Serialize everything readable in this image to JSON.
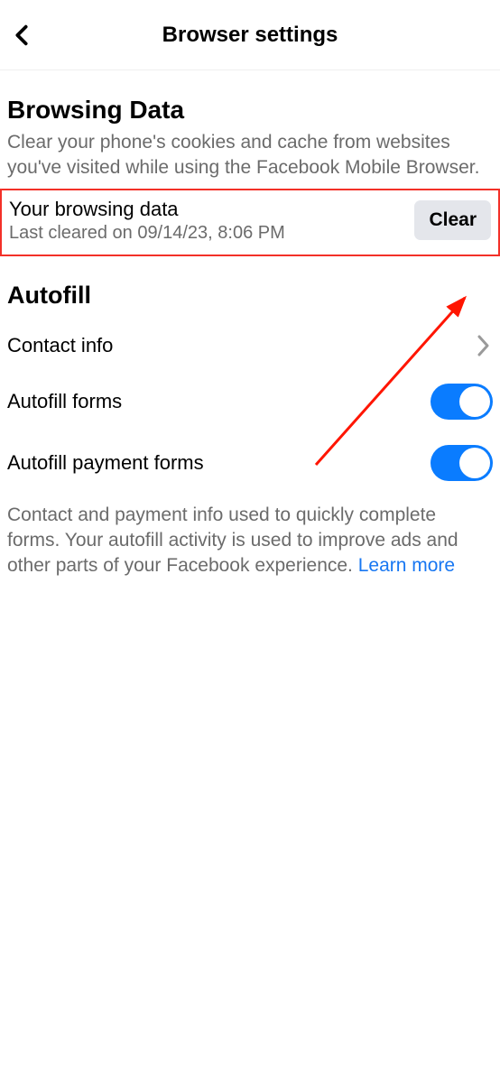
{
  "header": {
    "title": "Browser settings"
  },
  "browsingData": {
    "sectionTitle": "Browsing Data",
    "description": "Clear your phone's cookies and cache from websites you've visited while using the Facebook Mobile Browser.",
    "rowTitle": "Your browsing data",
    "rowSubtitle": "Last cleared on 09/14/23, 8:06 PM",
    "clearLabel": "Clear"
  },
  "autofill": {
    "sectionTitle": "Autofill",
    "contactLabel": "Contact info",
    "formsLabel": "Autofill forms",
    "paymentLabel": "Autofill payment forms",
    "description": "Contact and payment info used to quickly complete forms. Your autofill activity is used to improve ads and other parts of your Facebook experience. ",
    "learnMore": "Learn more"
  }
}
